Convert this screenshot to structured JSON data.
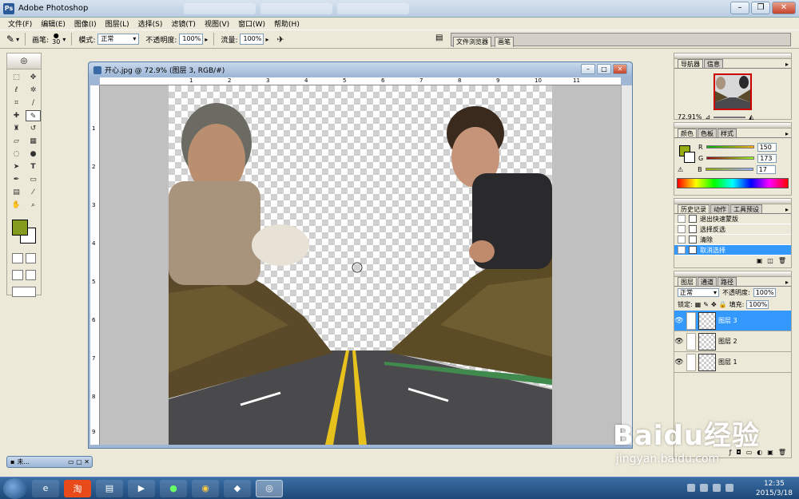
{
  "app": {
    "title": "Adobe Photoshop"
  },
  "menu": [
    "文件(F)",
    "编辑(E)",
    "图像(I)",
    "图层(L)",
    "选择(S)",
    "滤镜(T)",
    "视图(V)",
    "窗口(W)",
    "帮助(H)"
  ],
  "options": {
    "brush_label": "画笔:",
    "brush_size": "30",
    "mode_label": "模式:",
    "mode_value": "正常",
    "opacity_label": "不透明度:",
    "opacity_value": "100%",
    "flow_label": "流量:",
    "flow_value": "100%"
  },
  "dock": {
    "tab1": "文件浏览器",
    "tab2": "画笔"
  },
  "document": {
    "title": "开心.jpg @ 72.9% (图层 3, RGB/#)",
    "ruler_h": [
      "1",
      "2",
      "3",
      "4",
      "5",
      "6",
      "7",
      "8",
      "9",
      "10",
      "11"
    ],
    "ruler_v": [
      "1",
      "2",
      "3",
      "4",
      "5",
      "6",
      "7",
      "8",
      "9"
    ]
  },
  "navigator": {
    "tabs": [
      "导航器",
      "信息"
    ],
    "zoom": "72.91%"
  },
  "color": {
    "tabs": [
      "颜色",
      "色板",
      "样式"
    ],
    "r_label": "R",
    "r_value": "150",
    "g_label": "G",
    "g_value": "173",
    "b_label": "B",
    "b_value": "17",
    "foreground": "#96ad11"
  },
  "history": {
    "tabs": [
      "历史记录",
      "动作",
      "工具预设"
    ],
    "items": [
      "退出快速蒙版",
      "选择反选",
      "清除",
      "取消选择"
    ]
  },
  "layers": {
    "tabs": [
      "图层",
      "通道",
      "路径"
    ],
    "blend": "正常",
    "opacity_label": "不透明度:",
    "opacity": "100%",
    "lock_label": "锁定:",
    "fill_label": "填充:",
    "fill": "100%",
    "items": [
      "图层 3",
      "图层 2",
      "图层 1"
    ]
  },
  "minimized": {
    "label": "未..."
  },
  "taskbar": {
    "time": "12:35",
    "date": "2015/3/18"
  },
  "watermark": {
    "brand": "Baidu经验",
    "url": "jingyan.baidu.com"
  }
}
